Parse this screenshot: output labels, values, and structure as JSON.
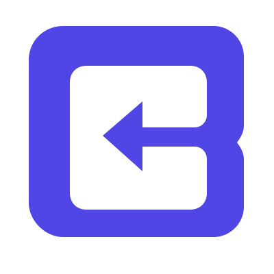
{
  "icon": {
    "name": "exit-arrow-logo-icon",
    "meaning": "logout-exit-left-arrow"
  },
  "colors": {
    "brand": "#4F46E5",
    "foreground": "#FFFFFF",
    "background": "#FFFFFF"
  }
}
